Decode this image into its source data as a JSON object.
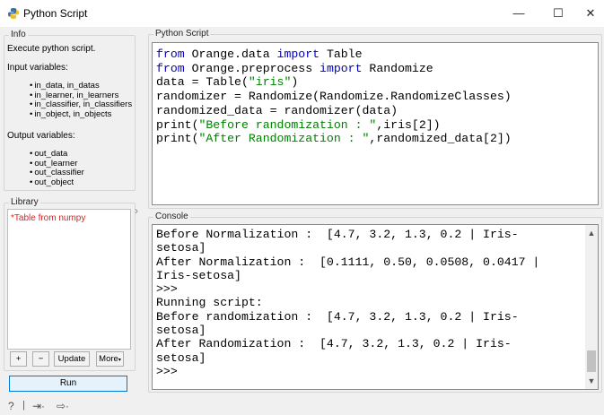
{
  "window": {
    "title": "Python Script",
    "minimize_glyph": "—",
    "maximize_glyph": "☐",
    "close_glyph": "✕"
  },
  "info": {
    "group_title": "Info",
    "description": "Execute python script.",
    "input_title": "Input variables:",
    "inputs": [
      "in_data, in_datas",
      "in_learner, in_learners",
      "in_classifier, in_classifiers",
      "in_object, in_objects"
    ],
    "output_title": "Output variables:",
    "outputs": [
      "out_data",
      "out_learner",
      "out_classifier",
      "out_object"
    ]
  },
  "library": {
    "group_title": "Library",
    "items": [
      "*Table from numpy"
    ],
    "add_label": "+",
    "remove_label": "−",
    "update_label": "Update",
    "more_label": "More"
  },
  "run_label": "Run",
  "script": {
    "group_title": "Python Script",
    "lines": [
      "from Orange.data import Table",
      "from Orange.preprocess import Randomize",
      "data = Table(\"iris\")",
      "randomizer = Randomize(Randomize.RandomizeClasses)",
      "randomized_data = randomizer(data)",
      "print(\"Before randomization : \",iris[2])",
      "print(\"After Randomization : \",randomized_data[2])"
    ]
  },
  "console": {
    "group_title": "Console",
    "lines": [
      "Before Normalization :  [4.7, 3.2, 1.3, 0.2 | Iris-",
      "setosa]",
      "After Normalization :  [0.1111, 0.50, 0.0508, 0.0417 |",
      "Iris-setosa]",
      ">>>",
      "Running script:",
      "Before randomization :  [4.7, 3.2, 1.3, 0.2 | Iris-",
      "setosa]",
      "After Randomization :  [4.7, 3.2, 1.3, 0.2 | Iris-",
      "setosa]",
      ">>>"
    ]
  },
  "icons": {
    "app": "python-icon",
    "help": "help-icon",
    "input": "input-icon",
    "output": "output-icon"
  }
}
